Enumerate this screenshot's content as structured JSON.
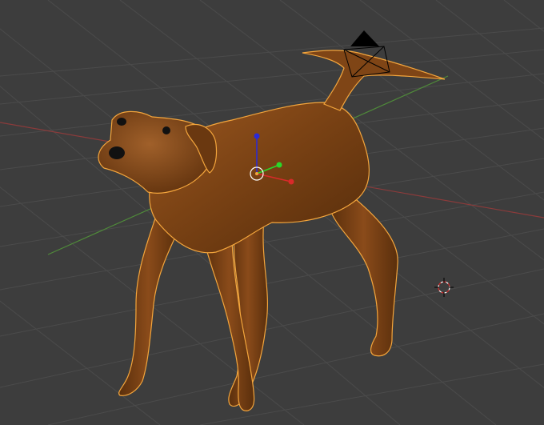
{
  "viewport": {
    "background": "#3d3d3d",
    "grid_color": "#4a4a4a",
    "x_axis_color": "#8a3b3b",
    "y_axis_color": "#4f8a3a"
  },
  "scene": {
    "object_name": "dog-model",
    "object_color": "#7a4214",
    "object_highlight": "#a05a22",
    "object_shadow": "#4e280a",
    "selection_outline_color": "#f3a53c",
    "eye_color": "#111111"
  },
  "gizmo": {
    "z_color": "#2a2ad8",
    "x_color": "#d82a2a",
    "y_color": "#2ad82a"
  },
  "camera": {
    "color": "#000000"
  }
}
